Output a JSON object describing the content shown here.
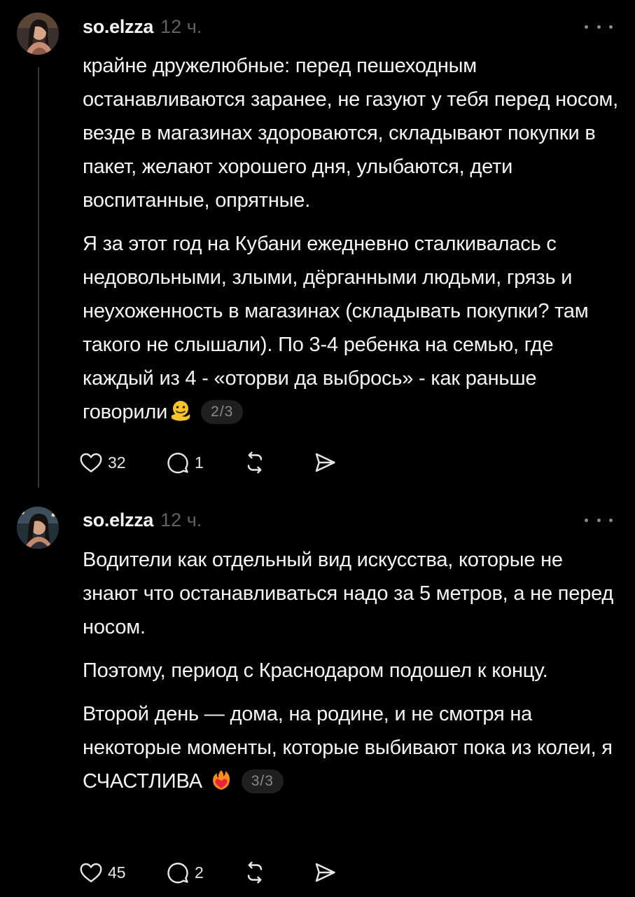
{
  "posts": [
    {
      "username": "so.elzza",
      "time": "12 ч.",
      "paragraphs": [
        "крайне дружелюбные: перед пешеходным останавливаются заранее, не газуют у тебя перед носом, везде в магазинах здороваются, складывают покупки в пакет, желают хорошего дня, улыбаются, дети воспитанные, опрятные.",
        "Я за этот год на Кубани ежедневно сталкивалась с недовольными, злыми, дёрганными людьми, грязь и неухоженность в магазинах (складывать покупки? там такого не слышали). По 3-4 ребенка на семью, где каждый из 4 - «оторви да выбрось» - как раньше говорили"
      ],
      "emoji": "melting-face-emoji",
      "page_indicator": "2/3",
      "likes": "32",
      "replies": "1"
    },
    {
      "username": "so.elzza",
      "time": "12 ч.",
      "paragraphs": [
        "Водители как отдельный вид искусства, которые не знают что останавливаться надо за 5 метров, а не перед носом.",
        "Поэтому, период с Краснодаром подошел к концу.",
        "Второй день — дома, на родине, и не смотря на некоторые моменты, которые выбивают пока из колеи, я СЧАСТЛИВА"
      ],
      "emoji": "heart-on-fire-emoji",
      "page_indicator": "3/3",
      "likes": "45",
      "replies": "2"
    }
  ],
  "colors": {
    "background": "#000000",
    "text_primary": "#f3f5f7",
    "text_secondary": "#616161",
    "thread_line": "#333638",
    "badge_bg": "#1f1f1f"
  }
}
